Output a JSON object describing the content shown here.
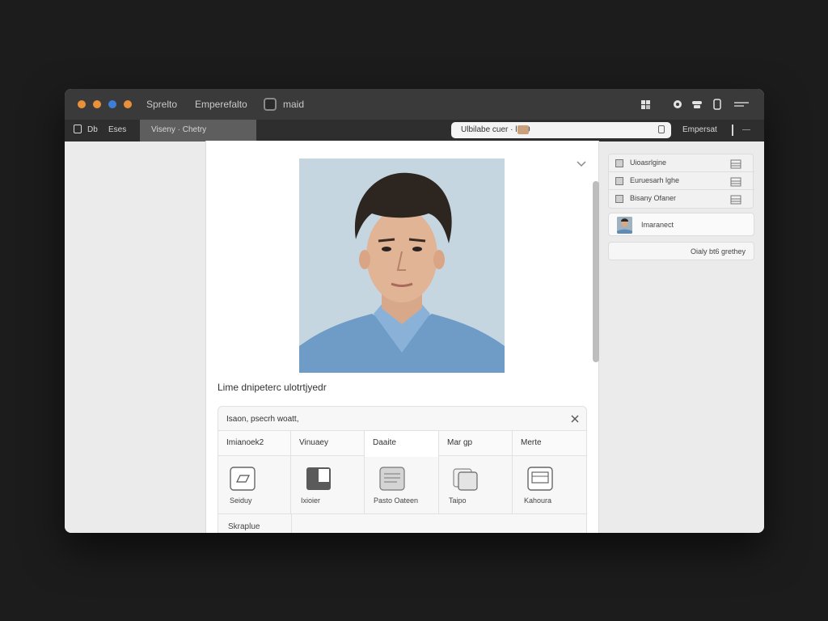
{
  "titlebar": {
    "dots": [
      "#e8913a",
      "#e8913a",
      "#3d7fd8",
      "#e8913a"
    ],
    "title_left": "Sprelto",
    "title_mid": "Emperefalto",
    "title_app": "maid",
    "icons": [
      "extension-icon",
      "settings-icon",
      "cloud-icon",
      "window-icon",
      "menu-icon"
    ]
  },
  "toolbar": {
    "tab_left_label": "Eses",
    "tab_left_prefix": "Db",
    "tab_active_label": "Viseny · Chetry",
    "url_text": "Ulbilabe cuer   · lotl0",
    "toolbar_right_label": "Empersat"
  },
  "sheet": {
    "caption": "Lime dnipeterc ulotrtjyedr",
    "panel_title": "Isaon, psecrh woatt,",
    "grid_headers": [
      "Imianoek2",
      "Vinuaey",
      "Daaite",
      "Mar gp",
      "Merte"
    ],
    "grid_cells": [
      {
        "label": "Seiduy",
        "icon": "parallelogram-icon"
      },
      {
        "label": "Ixioier",
        "icon": "image-tile-icon"
      },
      {
        "label": "Pasto Oateen",
        "icon": "document-icon"
      },
      {
        "label": "Taipo",
        "icon": "copy-icon"
      },
      {
        "label": "Kahoura",
        "icon": "frame-icon"
      }
    ],
    "bottom_label": "Skraplue"
  },
  "sidebar": {
    "list": [
      {
        "label": "Uioasrlgine"
      },
      {
        "label": "Euruesarh lghe"
      },
      {
        "label": "Bisany Ofaner"
      }
    ],
    "card_label": "Imaranect",
    "button_label": "Oialy bt6 grethey"
  }
}
